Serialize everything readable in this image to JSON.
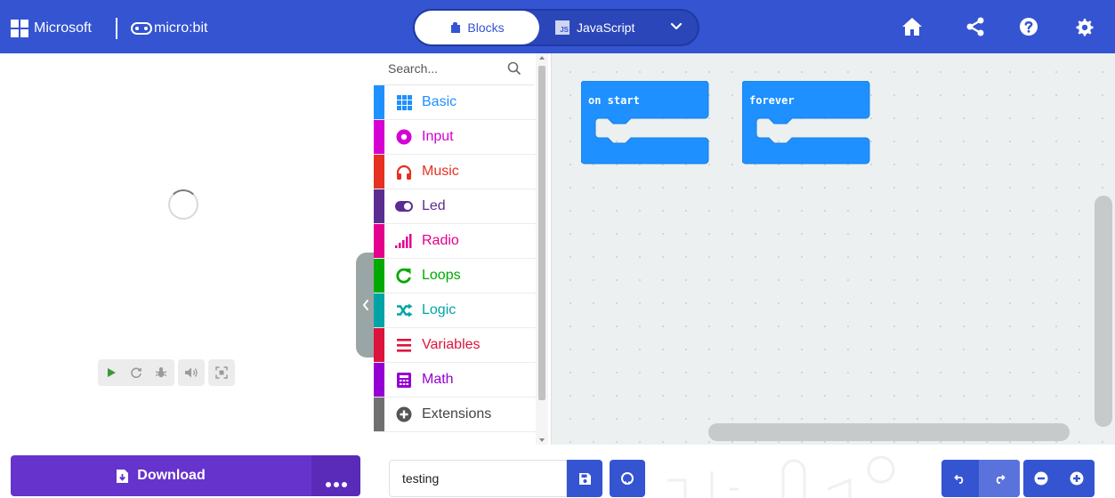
{
  "header": {
    "brand": "Microsoft",
    "product": "micro:bit",
    "tabs": [
      {
        "label": "Blocks",
        "active": true
      },
      {
        "label": "JavaScript",
        "active": false
      }
    ],
    "js_icon_text": "JS",
    "icons": [
      "home-icon",
      "share-icon",
      "help-icon",
      "settings-icon"
    ]
  },
  "simulator": {
    "state": "loading",
    "controls": [
      "play-icon",
      "restart-icon",
      "debug-icon",
      "sound-icon",
      "fullscreen-icon"
    ]
  },
  "toolbox": {
    "search_placeholder": "Search...",
    "categories": [
      {
        "label": "Basic",
        "color": "#1e90ff",
        "icon": "grid-icon"
      },
      {
        "label": "Input",
        "color": "#d400d4",
        "icon": "target-icon"
      },
      {
        "label": "Music",
        "color": "#e63022",
        "icon": "headphones-icon"
      },
      {
        "label": "Led",
        "color": "#5c2d91",
        "icon": "toggle-icon"
      },
      {
        "label": "Radio",
        "color": "#e3008c",
        "icon": "signal-bars-icon"
      },
      {
        "label": "Loops",
        "color": "#00aa00",
        "icon": "loop-arrow-icon"
      },
      {
        "label": "Logic",
        "color": "#00a4a6",
        "icon": "shuffle-icon"
      },
      {
        "label": "Variables",
        "color": "#dc143c",
        "icon": "list-lines-icon"
      },
      {
        "label": "Math",
        "color": "#9400d3",
        "icon": "calculator-icon"
      },
      {
        "label": "Extensions",
        "color": "#707070",
        "icon": "plus-circle-icon"
      }
    ]
  },
  "workspace": {
    "blocks": [
      {
        "label": "on start"
      },
      {
        "label": "forever"
      }
    ],
    "block_color": "#1e90ff"
  },
  "footer": {
    "download_label": "Download",
    "project_name": "testing"
  },
  "colors": {
    "header_bg": "#3454d1",
    "download_bg": "#6633cc",
    "workspace_bg": "#ecf0f1"
  }
}
